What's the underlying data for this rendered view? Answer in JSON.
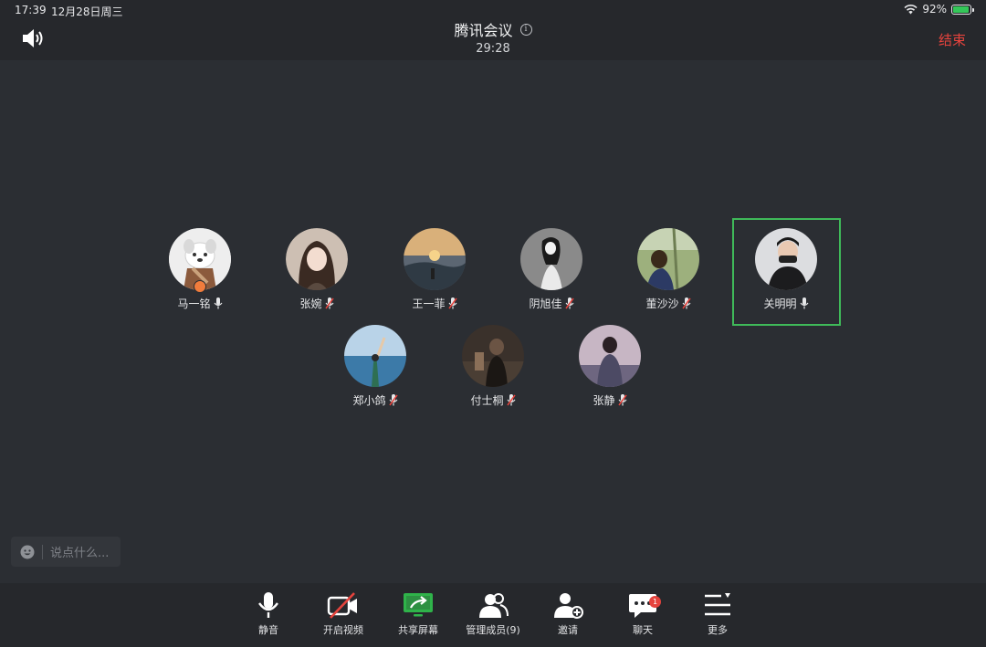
{
  "status_bar": {
    "time": "17:39",
    "date": "12月28日周三",
    "battery_percent": "92%",
    "battery_level": 0.92
  },
  "header": {
    "title": "腾讯会议",
    "timer": "29:28",
    "end_label": "结束"
  },
  "colors": {
    "accent_green": "#3fba59",
    "end_red": "#e5433d",
    "muted_red": "#e5433d",
    "background": "#2b2e33"
  },
  "participants": [
    {
      "name": "马一铭",
      "muted": false,
      "host": true
    },
    {
      "name": "张婉",
      "muted": true
    },
    {
      "name": "王一菲",
      "muted": true
    },
    {
      "name": "阴旭佳",
      "muted": true
    },
    {
      "name": "董沙沙",
      "muted": true
    },
    {
      "name": "关明明",
      "muted": false,
      "speaking": true
    },
    {
      "name": "郑小鸽",
      "muted": true
    },
    {
      "name": "付士桐",
      "muted": true
    },
    {
      "name": "张静",
      "muted": true
    }
  ],
  "chat": {
    "placeholder": "说点什么..."
  },
  "toolbar": {
    "mute": "静音",
    "video": "开启视频",
    "share": "共享屏幕",
    "members": "管理成员(9)",
    "invite": "邀请",
    "chat": "聊天",
    "chat_badge": "1",
    "more": "更多"
  }
}
